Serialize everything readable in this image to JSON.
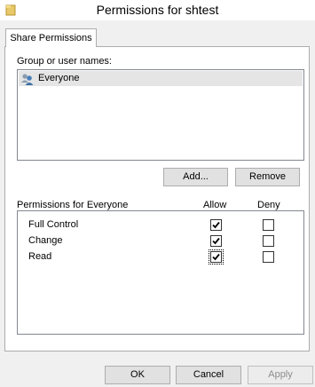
{
  "window": {
    "title": "Permissions for shtest"
  },
  "tabs": [
    {
      "label": "Share Permissions"
    }
  ],
  "group_section": {
    "label": "Group or user names:",
    "users": [
      {
        "name": "Everyone",
        "icon": "users-icon"
      }
    ],
    "add_label": "Add...",
    "remove_label": "Remove"
  },
  "permissions_section": {
    "label": "Permissions for Everyone",
    "allow_header": "Allow",
    "deny_header": "Deny",
    "rows": [
      {
        "name": "Full Control",
        "allow": true,
        "deny": false
      },
      {
        "name": "Change",
        "allow": true,
        "deny": false
      },
      {
        "name": "Read",
        "allow": true,
        "deny": false
      }
    ]
  },
  "footer": {
    "ok_label": "OK",
    "cancel_label": "Cancel",
    "apply_label": "Apply"
  }
}
